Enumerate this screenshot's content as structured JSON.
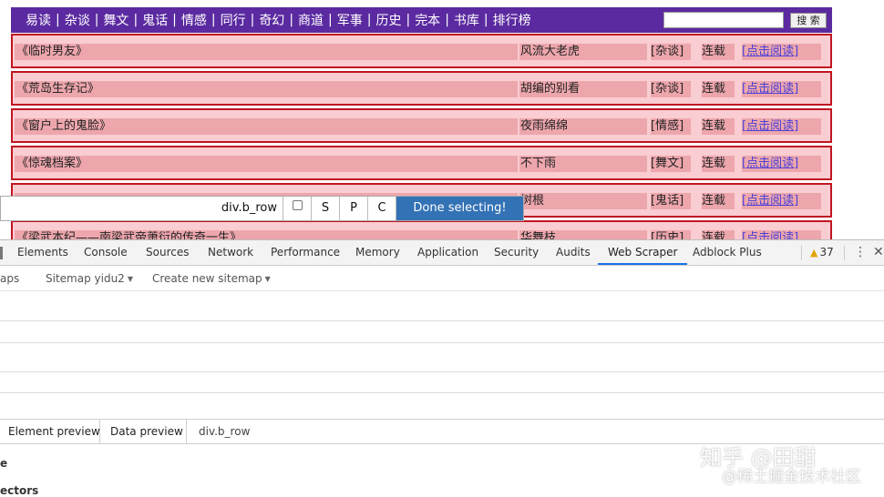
{
  "nav": {
    "links": [
      "易读",
      "杂谈",
      "舞文",
      "鬼话",
      "情感",
      "同行",
      "奇幻",
      "商道",
      "军事",
      "历史",
      "完本",
      "书库",
      "排行榜"
    ],
    "separator": "|",
    "search_placeholder": "",
    "search_button": "搜 索"
  },
  "books": [
    {
      "title": "《临时男友》",
      "author": "风流大老虎",
      "category": "[杂谈]",
      "status": "连载",
      "read": "[点击阅读]"
    },
    {
      "title": "《荒岛生存记》",
      "author": "胡编的别看",
      "category": "[杂谈]",
      "status": "连载",
      "read": "[点击阅读]"
    },
    {
      "title": "《窗户上的鬼脸》",
      "author": "夜雨绵绵",
      "category": "[情感]",
      "status": "连载",
      "read": "[点击阅读]"
    },
    {
      "title": "《惊魂档案》",
      "author": "不下雨",
      "category": "[舞文]",
      "status": "连载",
      "read": "[点击阅读]"
    },
    {
      "title": "",
      "author": "树根",
      "category": "[鬼话]",
      "status": "连载",
      "read": "[点击阅读]"
    },
    {
      "title": "《梁武本纪——南梁武帝萧衍的传奇一生》",
      "author": "华舞枝",
      "category": "[历史]",
      "status": "连载",
      "read": "[点击阅读]"
    }
  ],
  "selector_toolbar": {
    "selector": "div.b_row",
    "btn_s": "S",
    "btn_p": "P",
    "btn_c": "C",
    "done": "Done selecting!"
  },
  "devtools": {
    "tabs": [
      "Elements",
      "Console",
      "Sources",
      "Network",
      "Performance",
      "Memory",
      "Application",
      "Security",
      "Audits",
      "Web Scraper",
      "Adblock Plus"
    ],
    "active_tab": "Web Scraper",
    "warning_count": "37",
    "menu_icon": "⋮",
    "close_icon": "✕",
    "ws_nav": {
      "sitemaps": "aps",
      "sitemap": "Sitemap yidu2",
      "create": "Create new sitemap"
    },
    "bottom_tabs": {
      "element_preview": "Element preview",
      "data_preview": "Data preview",
      "selector": "div.b_row"
    },
    "frag1": "e",
    "frag2": "ectors"
  },
  "watermark": {
    "main": "知乎 @田甜",
    "sub": "@稀土掘金技术社区"
  }
}
